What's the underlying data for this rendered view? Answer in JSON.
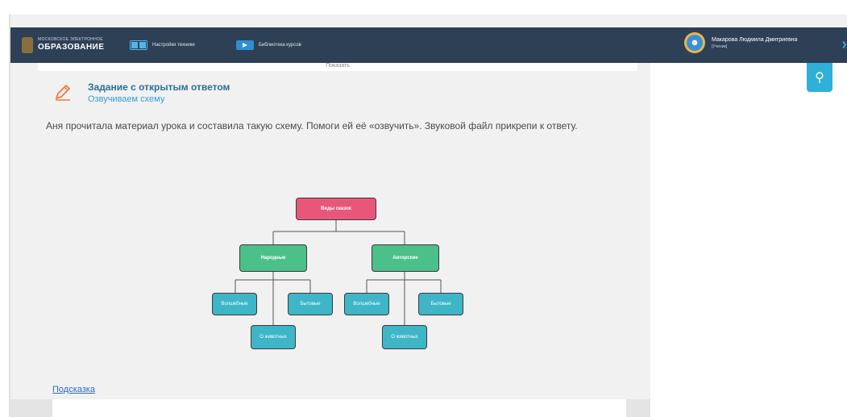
{
  "header": {
    "brand_small": "МОСКОВСКОЕ ЭЛЕКТРОННОЕ",
    "brand_big": "ОБРАЗОВАНИЕ",
    "nav": [
      {
        "label": "Настройки техники",
        "icon": "book-icon"
      },
      {
        "label": "Библиотека курсов",
        "icon": "video-icon"
      }
    ],
    "user_name": "Макарова Людмила Дмитриевна",
    "user_role": "[Ученик]"
  },
  "content": {
    "show_label": "Показать",
    "task_title": "Задание с открытым ответом",
    "task_subtitle": "Озвучиваем схему",
    "task_text": "Аня прочитала материал урока и составила такую схему. Помоги ей её «озвучить». Звуковой файл прикрепи к ответу.",
    "hint_link": "Подсказка"
  },
  "diagram": {
    "root": "Виды сказок",
    "left": {
      "label": "Народные",
      "children": [
        "Волшебные",
        "Бытовые",
        "О животных"
      ]
    },
    "right": {
      "label": "Авторские",
      "children": [
        "Волшебные",
        "Бытовые",
        "О животных"
      ]
    }
  },
  "colors": {
    "topbar": "#2e4056",
    "root_node": "#e8577a",
    "mid_node": "#4cc08a",
    "leaf_node": "#3eb6c8",
    "accent": "#2fb0d8"
  }
}
